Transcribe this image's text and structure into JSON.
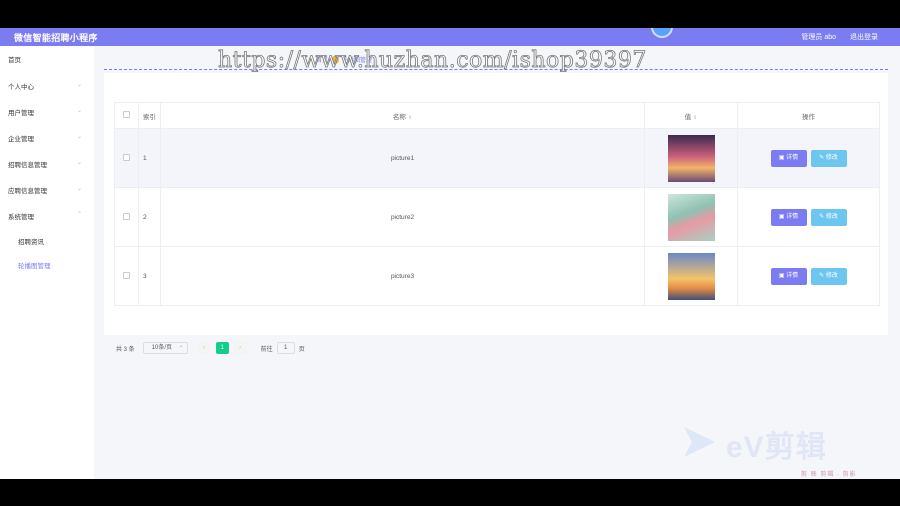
{
  "app": {
    "title": "微信智能招聘小程序"
  },
  "header": {
    "user_label": "管理员 abo",
    "logout_label": "退出登录"
  },
  "sidebar": {
    "items": [
      {
        "label": "首页"
      },
      {
        "label": "个人中心"
      },
      {
        "label": "用户管理"
      },
      {
        "label": "企业管理"
      },
      {
        "label": "招聘信息管理"
      },
      {
        "label": "应聘信息管理"
      },
      {
        "label": "系统管理"
      }
    ],
    "subitems": [
      {
        "label": "招聘资讯"
      },
      {
        "label": "轮播图管理"
      }
    ]
  },
  "breadcrumb": {
    "home": "首页",
    "current": "轮播图管理"
  },
  "watermark": "https://www.huzhan.com/ishop39397",
  "table": {
    "headers": {
      "index": "索引",
      "name": "名称",
      "value": "值",
      "actions": "操作"
    },
    "rows": [
      {
        "index": "1",
        "name": "picture1"
      },
      {
        "index": "2",
        "name": "picture2"
      },
      {
        "index": "3",
        "name": "picture3"
      }
    ],
    "detail_label": "详情",
    "edit_label": "修改"
  },
  "pagination": {
    "total": "共 3 条",
    "page_size": "10条/页",
    "prev": "‹",
    "current_page": "1",
    "next": "›",
    "goto_label": "前往",
    "goto_value": "1",
    "page_suffix": "页"
  },
  "overlay": {
    "ev_text": "eV剪辑",
    "ev_footer": "剪 映 剪辑 · 剪影"
  },
  "colors": {
    "accent": "#7b7bf2",
    "edit": "#6cc6f0",
    "page_active": "#13ce8a"
  }
}
